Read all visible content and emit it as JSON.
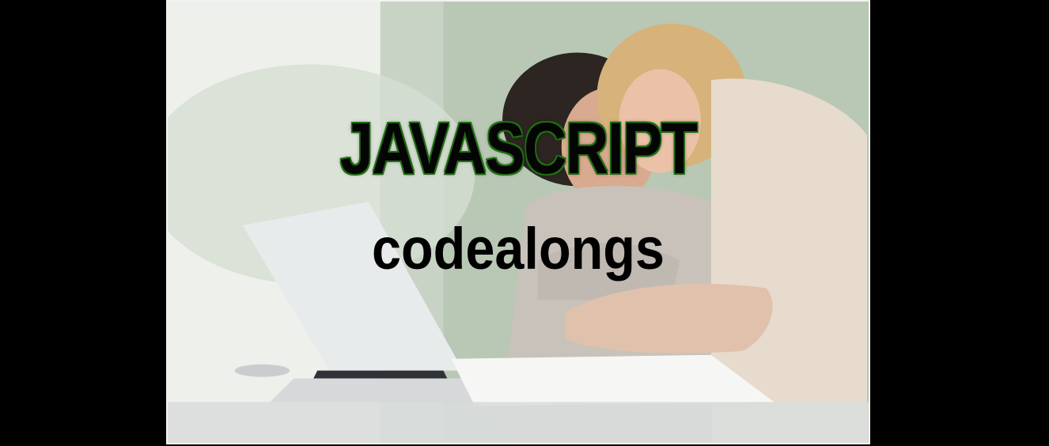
{
  "banner": {
    "title": "JAVASCRIPT",
    "subtitle": "codealongs",
    "title_outline_color": "#1f6d12",
    "text_color": "#000000",
    "background_color": "#000000",
    "frame_border_color": "#f2f2f2"
  }
}
